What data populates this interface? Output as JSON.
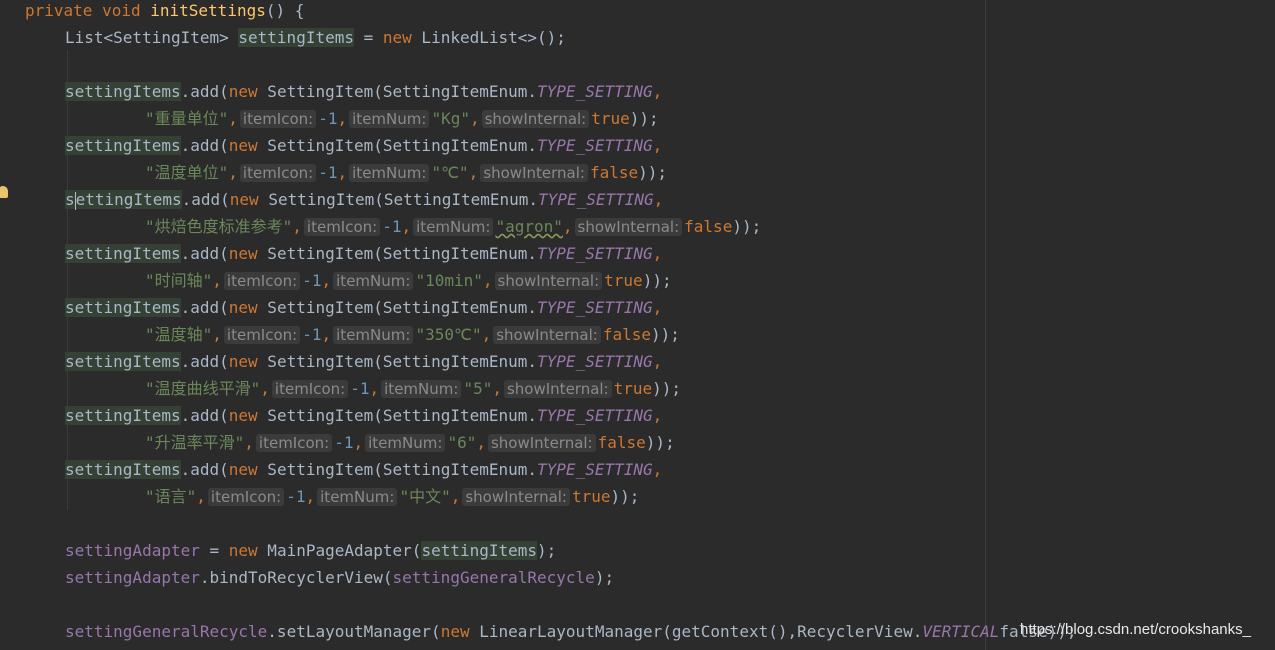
{
  "editor": {
    "lines": {
      "l0": {
        "kw1": "private",
        "kw2": "void",
        "fn": "initSettings",
        "rest": "() {"
      },
      "l1": {
        "type": "List<SettingItem> ",
        "var": "settingItems",
        "eq": " = ",
        "kw": "new",
        "rest": " LinkedList<>();"
      },
      "items": [
        {
          "label": "\"重量单位\"",
          "num": "\"Kg\"",
          "show": "true"
        },
        {
          "label": "\"温度单位\"",
          "num": "\"℃\"",
          "show": "false"
        },
        {
          "label": "\"烘焙色度标准参考\"",
          "num": "\"agron\"",
          "show": "false"
        },
        {
          "label": "\"时间轴\"",
          "num": "\"10min\"",
          "show": "true"
        },
        {
          "label": "\"温度轴\"",
          "num": "\"350℃\"",
          "show": "false"
        },
        {
          "label": "\"温度曲线平滑\"",
          "num": "\"5\"",
          "show": "true"
        },
        {
          "label": "\"升温率平滑\"",
          "num": "\"6\"",
          "show": "false"
        },
        {
          "label": "\"语言\"",
          "num": "\"中文\"",
          "show": "true"
        }
      ],
      "common": {
        "var": "settingItems",
        "add": ".add(",
        "kw": "new",
        "ctor": " SettingItem(SettingItemEnum.",
        "enum": "TYPE_SETTING",
        "comma": ",",
        "hint_icon": "itemIcon:",
        "neg": "-1",
        "hint_num": "itemNum:",
        "hint_show": "showInternal:",
        "close": "));"
      },
      "adapter1": {
        "field": "settingAdapter",
        "eq": " = ",
        "kw": "new",
        "ctor": " MainPageAdapter(",
        "arg": "settingItems",
        "close": ");"
      },
      "adapter2": {
        "field": "settingAdapter",
        "call": ".bindToRecyclerView(",
        "arg": "settingGeneralRecycle",
        "close": ");"
      },
      "layout": {
        "field": "settingGeneralRecycle",
        "call": ".setLayoutManager(",
        "kw": "new",
        "ctor": " LinearLayoutManager(getContext(),RecyclerView.",
        "enum": "VERTICAL",
        "tail": "false));"
      }
    },
    "watermark": "https://blog.csdn.net/crookshanks_"
  }
}
